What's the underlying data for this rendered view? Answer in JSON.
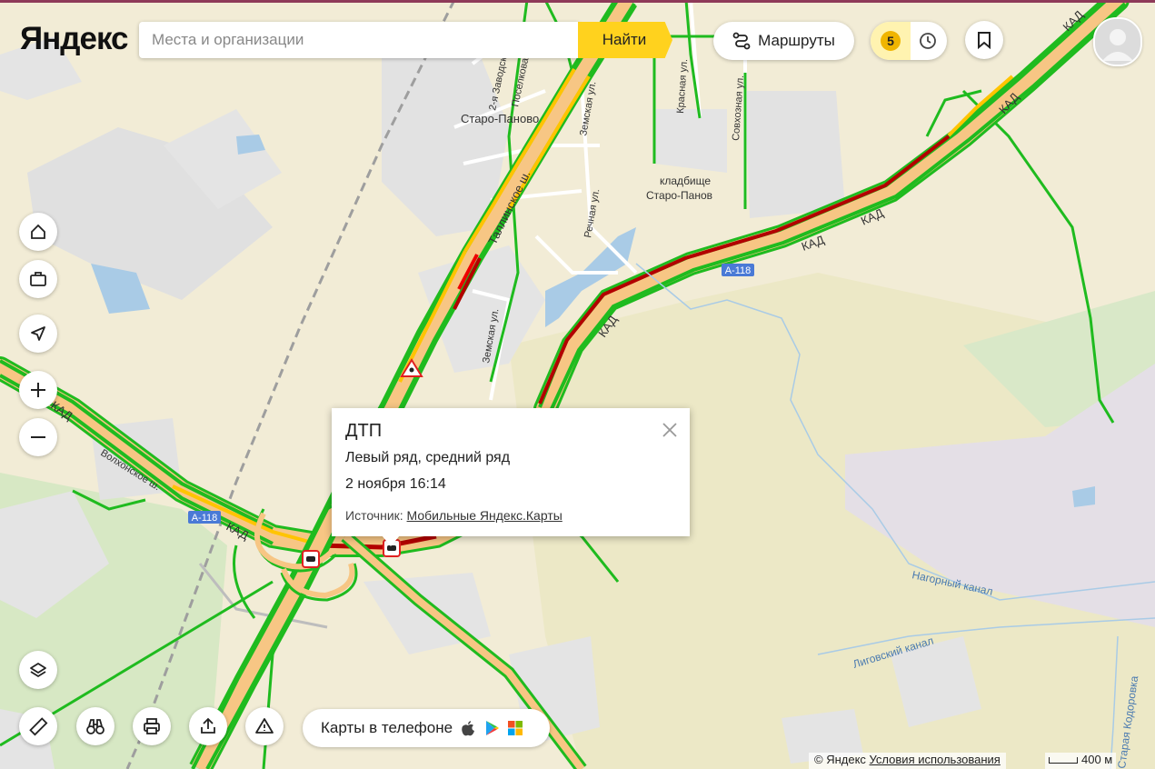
{
  "header": {
    "logo": "Яндекс",
    "search_placeholder": "Места и организации",
    "find_label": "Найти",
    "routes_label": "Маршруты",
    "traffic_score": "5"
  },
  "popup": {
    "title": "ДТП",
    "lanes": "Левый ряд, средний ряд",
    "time": "2 ноября 16:14",
    "source_label": "Источник:",
    "source_link": "Мобильные Яндекс.Карты"
  },
  "map_labels": {
    "staro_panovo": "Старо-Паново",
    "cemetery_1": "кладбище",
    "cemetery_2": "Старо-Панов",
    "rechnaya": "Речная ул.",
    "zemskaya": "Земская ул.",
    "zavodskaya": "2-я Заводская",
    "poselkovaya": "Поселковая",
    "krasnaya": "Красная ул.",
    "sovkhoznaya": "Совхозная ул.",
    "tallinskoe": "Таллинское ш.",
    "kad": "КАД",
    "a118": "А-118",
    "nagorny": "Нагорный канал",
    "ligovsky": "Лиговский канал",
    "kodorovka": "Старая Кодоровка",
    "volkhonskoe": "Волхонское ш."
  },
  "bottom": {
    "phone_label": "Карты в телефоне"
  },
  "footer": {
    "copyright": "© Яндекс",
    "terms": "Условия использования",
    "scale": "400 м"
  },
  "colors": {
    "free": "#1fbb1f",
    "slow": "#ffc400",
    "jam": "#b30000",
    "road_fill": "#f7c684",
    "brand_yellow": "#ffd21e"
  }
}
